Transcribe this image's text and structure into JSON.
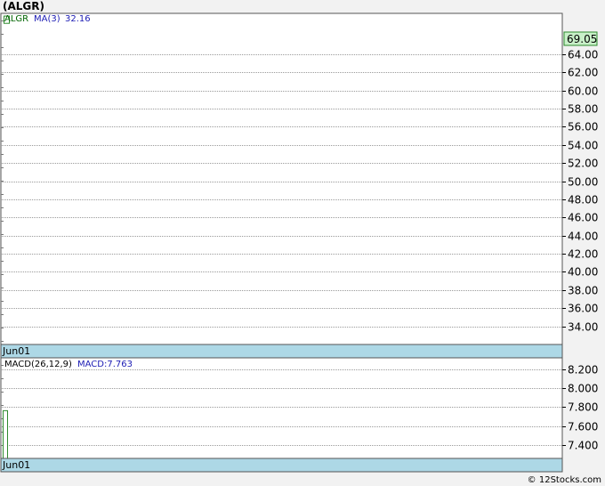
{
  "header": {
    "title": "(ALGR)"
  },
  "footer": {
    "copyright": "© 12Stocks.com"
  },
  "colors": {
    "price_legend": "#006400",
    "ma_legend": "#1c1cb4",
    "macd_legend": "#1c1cb4",
    "date_bar": "#add8e6",
    "tag_bg": "#c8f0c8",
    "tag_border": "#2e8b2e",
    "candle": "#2e8b2e"
  },
  "chart_data": [
    {
      "type": "candlestick",
      "legend": {
        "symbol": "ALGR",
        "ma_label": "MA(3)",
        "ma_value": "32.16"
      },
      "last_price": "69.05",
      "ylim": [
        32,
        68.5
      ],
      "y_ticks": [
        "34.00",
        "36.00",
        "38.00",
        "40.00",
        "42.00",
        "44.00",
        "46.00",
        "48.00",
        "50.00",
        "52.00",
        "54.00",
        "56.00",
        "58.00",
        "60.00",
        "62.00",
        "64.00"
      ],
      "x_label": "Jun01",
      "points": [
        {
          "open": 68.2,
          "close": 67.4
        }
      ]
    },
    {
      "type": "bar",
      "legend": {
        "indicator": "MACD(26,12,9)",
        "macd_label": "MACD:7.763"
      },
      "ylim": [
        7.26,
        8.32
      ],
      "y_ticks": [
        "7.400",
        "7.600",
        "7.800",
        "8.000",
        "8.200"
      ],
      "x_label": "Jun01",
      "values": [
        7.763
      ]
    }
  ]
}
